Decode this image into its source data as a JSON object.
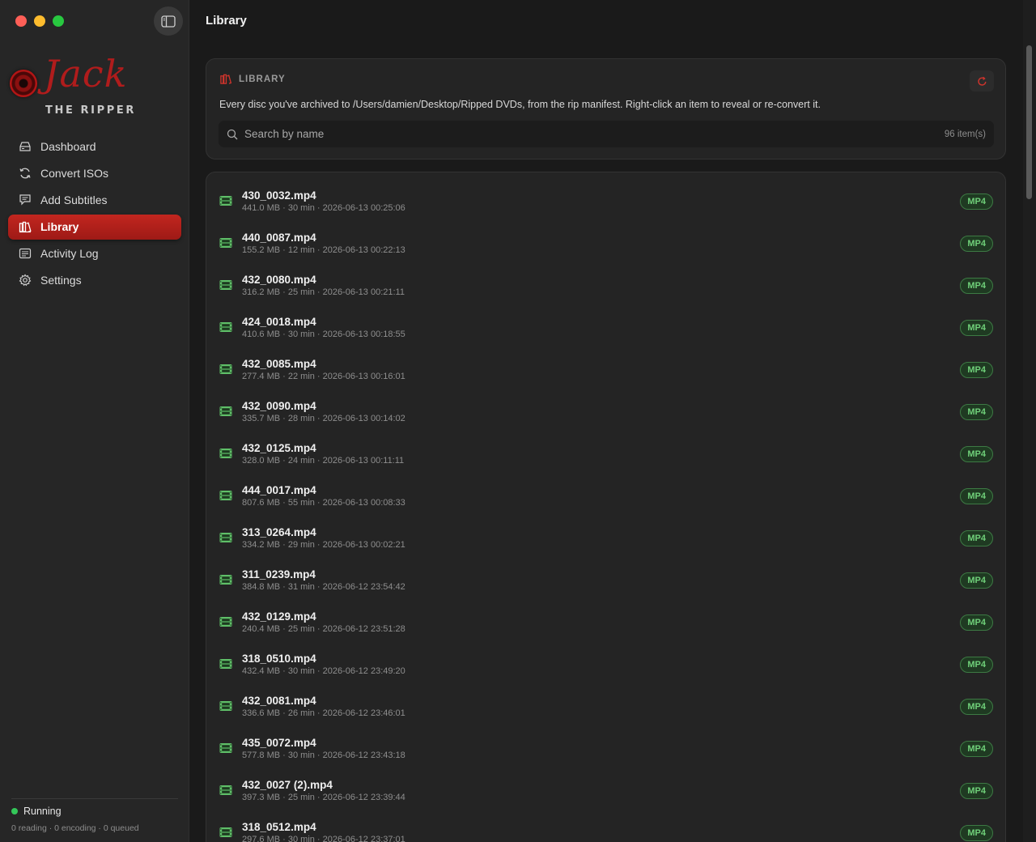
{
  "window": {
    "title": "Library"
  },
  "brand": {
    "name": "Jack",
    "tagline": "THE RIPPER"
  },
  "nav": [
    {
      "label": "Dashboard",
      "icon": "tray-icon",
      "active": false
    },
    {
      "label": "Convert ISOs",
      "icon": "convert-icon",
      "active": false
    },
    {
      "label": "Add Subtitles",
      "icon": "subtitles-icon",
      "active": false
    },
    {
      "label": "Library",
      "icon": "library-icon",
      "active": true
    },
    {
      "label": "Activity Log",
      "icon": "log-icon",
      "active": false
    },
    {
      "label": "Settings",
      "icon": "gear-icon",
      "active": false
    }
  ],
  "status": {
    "label": "Running",
    "detail": "0 reading · 0 encoding · 0 queued"
  },
  "header": {
    "section_label": "LIBRARY",
    "description": "Every disc you've archived to /Users/damien/Desktop/Ripped DVDs, from the rip manifest. Right-click an item to reveal or re-convert it.",
    "search_placeholder": "Search by name",
    "item_count": "96 item(s)"
  },
  "items": [
    {
      "name": "430_0032.mp4",
      "meta": "441.0 MB · 30 min · 2026-06-13 00:25:06",
      "badge": "MP4"
    },
    {
      "name": "440_0087.mp4",
      "meta": "155.2 MB · 12 min · 2026-06-13 00:22:13",
      "badge": "MP4"
    },
    {
      "name": "432_0080.mp4",
      "meta": "316.2 MB · 25 min · 2026-06-13 00:21:11",
      "badge": "MP4"
    },
    {
      "name": "424_0018.mp4",
      "meta": "410.6 MB · 30 min · 2026-06-13 00:18:55",
      "badge": "MP4"
    },
    {
      "name": "432_0085.mp4",
      "meta": "277.4 MB · 22 min · 2026-06-13 00:16:01",
      "badge": "MP4"
    },
    {
      "name": "432_0090.mp4",
      "meta": "335.7 MB · 28 min · 2026-06-13 00:14:02",
      "badge": "MP4"
    },
    {
      "name": "432_0125.mp4",
      "meta": "328.0 MB · 24 min · 2026-06-13 00:11:11",
      "badge": "MP4"
    },
    {
      "name": "444_0017.mp4",
      "meta": "807.6 MB · 55 min · 2026-06-13 00:08:33",
      "badge": "MP4"
    },
    {
      "name": "313_0264.mp4",
      "meta": "334.2 MB · 29 min · 2026-06-13 00:02:21",
      "badge": "MP4"
    },
    {
      "name": "311_0239.mp4",
      "meta": "384.8 MB · 31 min · 2026-06-12 23:54:42",
      "badge": "MP4"
    },
    {
      "name": "432_0129.mp4",
      "meta": "240.4 MB · 25 min · 2026-06-12 23:51:28",
      "badge": "MP4"
    },
    {
      "name": "318_0510.mp4",
      "meta": "432.4 MB · 30 min · 2026-06-12 23:49:20",
      "badge": "MP4"
    },
    {
      "name": "432_0081.mp4",
      "meta": "336.6 MB · 26 min · 2026-06-12 23:46:01",
      "badge": "MP4"
    },
    {
      "name": "435_0072.mp4",
      "meta": "577.8 MB · 30 min · 2026-06-12 23:43:18",
      "badge": "MP4"
    },
    {
      "name": "432_0027 (2).mp4",
      "meta": "397.3 MB · 25 min · 2026-06-12 23:39:44",
      "badge": "MP4"
    },
    {
      "name": "318_0512.mp4",
      "meta": "297.6 MB · 30 min · 2026-06-12 23:37:01",
      "badge": "MP4"
    }
  ],
  "colors": {
    "accent": "#c2261f",
    "badge_text": "#6fcf79",
    "status_ok": "#34c759"
  }
}
